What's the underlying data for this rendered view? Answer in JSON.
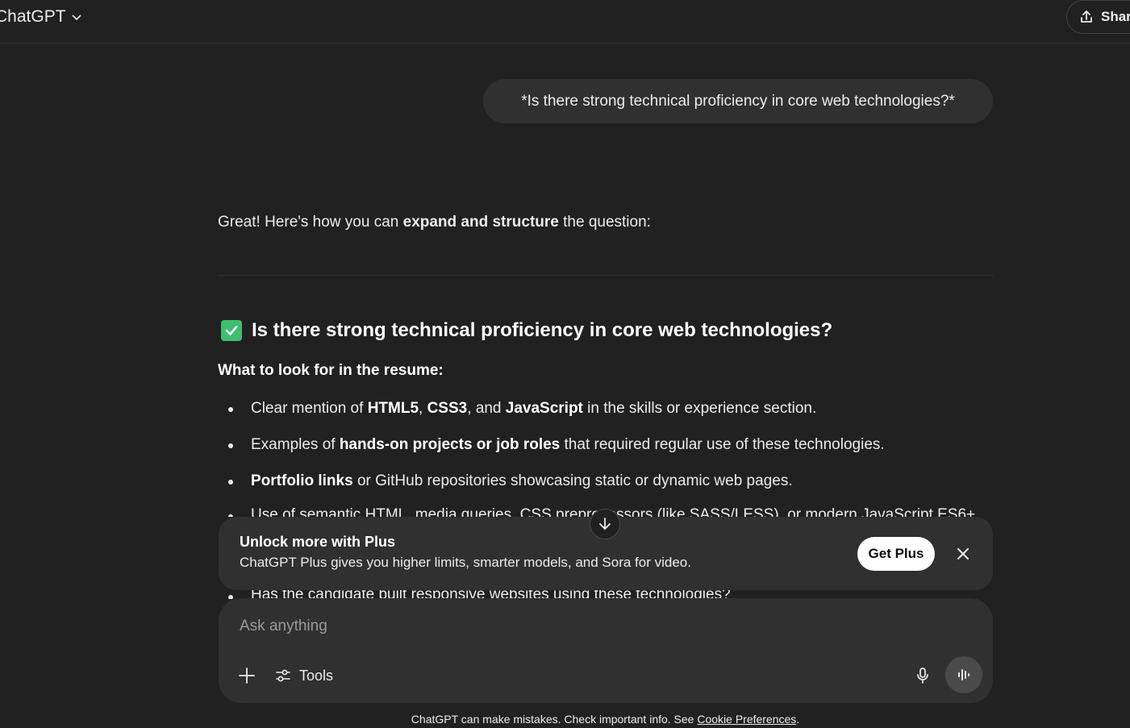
{
  "header": {
    "title": "ChatGPT",
    "share_label": "Share"
  },
  "user_message": "*Is there strong technical proficiency in core web technologies?*",
  "assistant": {
    "intro_pre": "Great! Here's how you can ",
    "intro_bold": "expand and structure",
    "intro_post": " the question:",
    "heading": "Is there strong technical proficiency in core web technologies?",
    "subheading": "What to look for in the resume:",
    "bullets": [
      {
        "parts": [
          {
            "t": "Clear mention of ",
            "b": false
          },
          {
            "t": "HTML5",
            "b": true
          },
          {
            "t": ", ",
            "b": false
          },
          {
            "t": "CSS3",
            "b": true
          },
          {
            "t": ", and ",
            "b": false
          },
          {
            "t": "JavaScript",
            "b": true
          },
          {
            "t": " in the skills or experience section.",
            "b": false
          }
        ]
      },
      {
        "parts": [
          {
            "t": "Examples of ",
            "b": false
          },
          {
            "t": "hands-on projects or job roles",
            "b": true
          },
          {
            "t": " that required regular use of these technologies.",
            "b": false
          }
        ]
      },
      {
        "parts": [
          {
            "t": "Portfolio links",
            "b": true
          },
          {
            "t": " or GitHub repositories showcasing static or dynamic web pages.",
            "b": false
          }
        ]
      }
    ],
    "clipped_bullet_1": "Use of semantic HTML, media queries, CSS preprocessors (like SASS/LESS), or modern JavaScript ES6+",
    "clipped_bullet_2": "Has the candidate built responsive websites using these technologies?"
  },
  "banner": {
    "title": "Unlock more with Plus",
    "body": "ChatGPT Plus gives you higher limits, smarter models, and Sora for video.",
    "cta": "Get Plus"
  },
  "composer": {
    "placeholder": "Ask anything",
    "tools_label": "Tools"
  },
  "footer": {
    "text": "ChatGPT can make mistakes. Check important info. See ",
    "link": "Cookie Preferences",
    "end": "."
  },
  "icons": {
    "check": "check-box-icon",
    "share": "share-upload-icon",
    "close": "close-icon",
    "plus": "plus-icon",
    "tools": "sliders-icon",
    "mic": "microphone-icon",
    "voice": "voice-waveform-icon",
    "scroll": "arrow-down-icon"
  },
  "colors": {
    "background": "#212121",
    "bubble": "#303030",
    "check": "#3fbf6f",
    "text": "#ececec"
  }
}
